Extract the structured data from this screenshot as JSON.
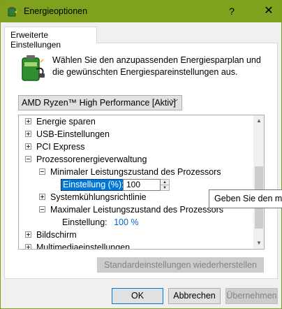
{
  "window": {
    "title": "Energieoptionen",
    "help_glyph": "?",
    "close_glyph": "✕",
    "titlebar_color": "#7fa11d"
  },
  "tab": {
    "label": "Erweiterte Einstellungen"
  },
  "description": "Wählen Sie den anzupassenden Energiesparplan und die gewünschten Energiespareinstellungen aus.",
  "plan_select": {
    "value": "AMD Ryzen™ High Performance [Aktiv]",
    "icon": "chevron-down-icon"
  },
  "tree": {
    "items": [
      {
        "label": "Energie sparen",
        "state": "collapsed"
      },
      {
        "label": "USB-Einstellungen",
        "state": "collapsed"
      },
      {
        "label": "PCI Express",
        "state": "collapsed"
      },
      {
        "label": "Prozessorenergieverwaltung",
        "state": "expanded"
      },
      {
        "label": "Minimaler Leistungszustand des Prozessors",
        "state": "expanded"
      },
      {
        "label": "Einstellung (%):",
        "value": "100",
        "selected": true
      },
      {
        "label": "Systemkühlungsrichtlinie",
        "state": "collapsed"
      },
      {
        "label": "Maximaler Leistungszustand des Prozessors",
        "state": "expanded"
      },
      {
        "label": "Einstellung:",
        "value": "100 %"
      },
      {
        "label": "Bildschirm",
        "state": "collapsed"
      },
      {
        "label": "Multimediaeinstellungen",
        "state": "collapsed"
      }
    ]
  },
  "tooltip": "Geben Sie den min",
  "restore_button": "Standardeinstellungen wiederherstellen",
  "buttons": {
    "ok": "OK",
    "cancel": "Abbrechen",
    "apply": "Übernehmen"
  },
  "colors": {
    "selection": "#0078d7",
    "value_link": "#0066cc"
  }
}
